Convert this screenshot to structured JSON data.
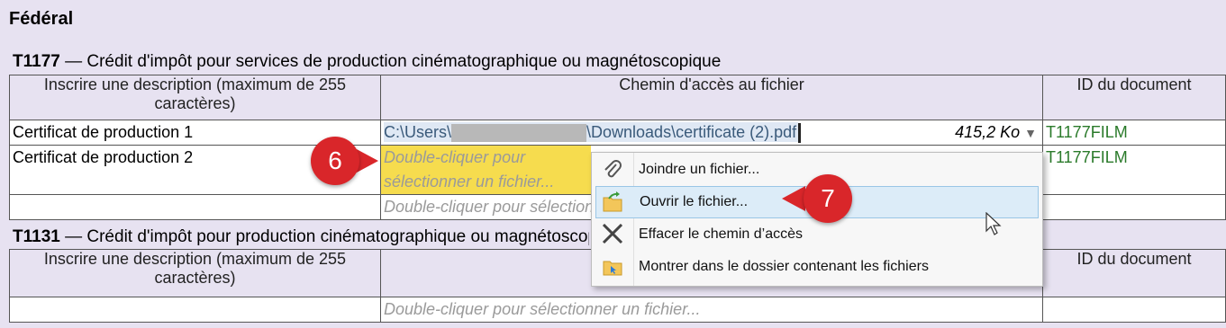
{
  "heading": "Fédéral",
  "sections": [
    {
      "code": "T1177",
      "title": " — Crédit d'impôt pour services de production cinématographique ou magnétoscopique",
      "headers": {
        "description": "Inscrire une description (maximum de 255 caractères)",
        "path": "Chemin d'accès au fichier",
        "docid": "ID du document"
      },
      "rows": [
        {
          "description": "Certificat de production 1",
          "path_prefix": "C:\\Users\\",
          "path_suffix": "\\Downloads\\certificate (2).pdf",
          "size": "415,2 Ko",
          "docid": "T1177FILM"
        },
        {
          "description": "Certificat de production 2",
          "path_placeholder": "Double-cliquer pour sélectionner un fichier...",
          "docid": "T1177FILM"
        },
        {
          "description": "",
          "path_placeholder": "Double-cliquer pour sélectionner un fichier...",
          "docid": ""
        }
      ]
    },
    {
      "code": "T1131",
      "title": " — Crédit d'impôt pour production cinématographique ou magnétoscopique canadienne",
      "headers": {
        "description": "Inscrire une description (maximum de 255 caractères)",
        "path": "",
        "docid": "ID du document"
      },
      "rows": [
        {
          "description": "",
          "path_placeholder": "Double-cliquer pour sélectionner un fichier...",
          "docid": ""
        }
      ]
    }
  ],
  "context_menu": {
    "items": [
      {
        "label": "Joindre un fichier...",
        "icon": "paperclip-icon"
      },
      {
        "label": "Ouvrir le fichier...",
        "icon": "folder-open-icon"
      },
      {
        "label": "Effacer le chemin d’accès",
        "icon": "close-x-icon"
      },
      {
        "label": "Montrer dans le dossier contenant les fichiers",
        "icon": "folder-show-icon"
      }
    ],
    "hovered_index": 1
  },
  "callouts": {
    "step6": "6",
    "step7": "7"
  },
  "colors": {
    "badge": "#d9262a",
    "docid": "#2a7a2a",
    "placeholder_highlight": "#f6dc4e"
  }
}
